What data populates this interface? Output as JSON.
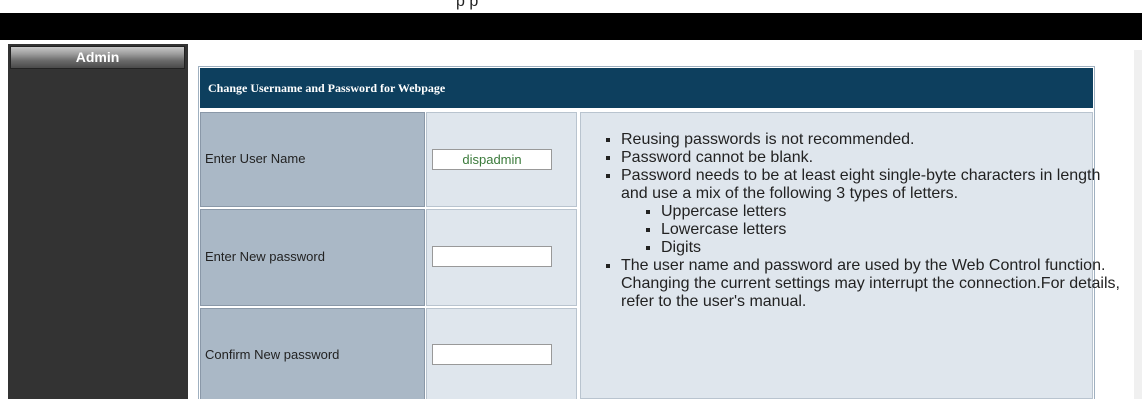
{
  "header": {
    "title": "p p"
  },
  "sidebar": {
    "items": [
      {
        "label": "Admin"
      }
    ]
  },
  "panel": {
    "title": "Change Username and Password for Webpage",
    "fields": [
      {
        "label": "Enter User Name",
        "value": "dispadmin",
        "placeholder": ""
      },
      {
        "label": "Enter New password",
        "value": "",
        "placeholder": ""
      },
      {
        "label": "Confirm New password",
        "value": "",
        "placeholder": ""
      }
    ],
    "notes": {
      "items": [
        "Reusing passwords is not recommended.",
        "Password cannot be blank.",
        "Password needs to be at least eight single-byte characters in length and use a mix of the following 3 types of letters.",
        "The user name and password are used by the Web Control function. Changing the current settings may interrupt the connection.For details, refer to the user's manual."
      ],
      "subitems": [
        "Uppercase letters",
        "Lowercase letters",
        "Digits"
      ]
    }
  },
  "colors": {
    "header_bg": "#0d3f5e",
    "label_bg": "#aab8c6",
    "cell_bg": "#dfe6ed",
    "sidebar_bg": "#333333",
    "username_text": "#3a7a3a"
  }
}
